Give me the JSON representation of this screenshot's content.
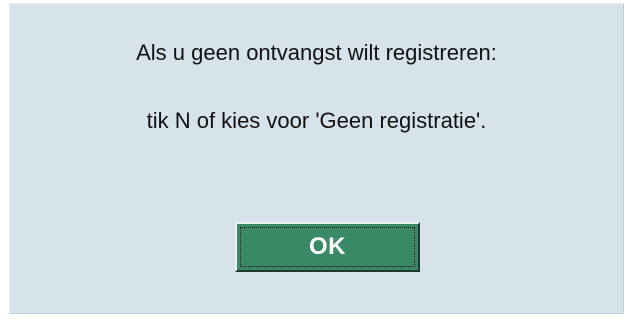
{
  "dialog": {
    "message_line_1": "Als u geen ontvangst wilt registreren:",
    "message_line_2": "tik N of kies voor 'Geen registratie'.",
    "ok_label": "OK"
  },
  "colors": {
    "dialog_background": "#d6e3ea",
    "button_background": "#3b8a67",
    "button_text": "#ffffff"
  }
}
